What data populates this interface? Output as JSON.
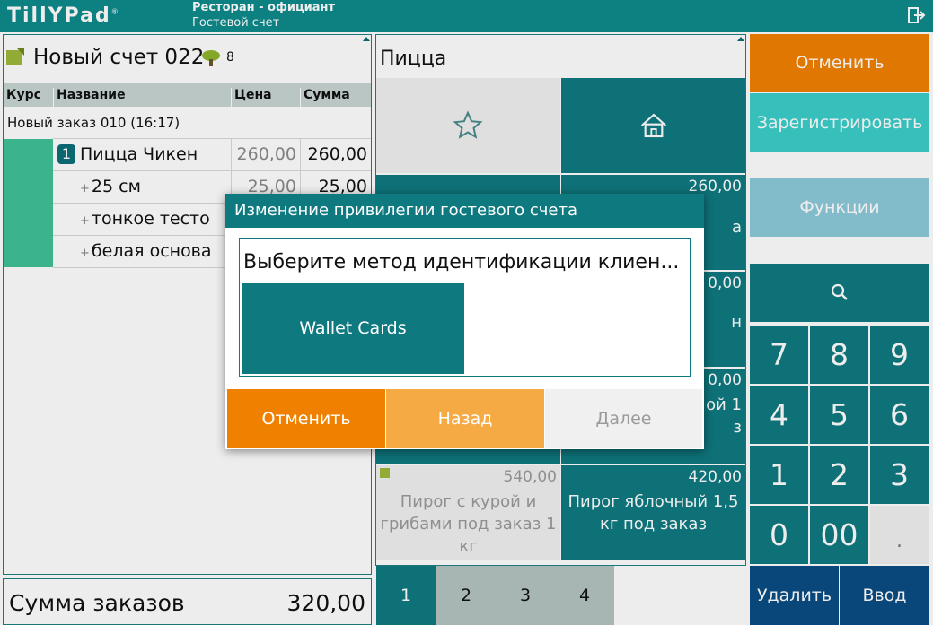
{
  "topbar": {
    "logo": "TillYPad",
    "title": "Ресторан - официант",
    "subtitle": "Гостевой счет",
    "logout_icon": "logout-icon"
  },
  "bill": {
    "title": "Новый счет 022",
    "guests": "8",
    "columns": {
      "course": "Курс",
      "name": "Название",
      "price": "Цена",
      "sum": "Сумма"
    },
    "order_label": "Новый заказ 010 (16:17)",
    "items": [
      {
        "qty": "1",
        "name": "Пицца Чикен",
        "price": "260,00",
        "sum": "260,00"
      },
      {
        "name": "25 см",
        "price": "25,00",
        "sum": "25,00"
      },
      {
        "name": "тонкое тесто",
        "price": "",
        "sum": ""
      },
      {
        "name": "белая основа",
        "price": "",
        "sum": ""
      }
    ],
    "total_label": "Сумма заказов",
    "total_value": "320,00",
    "course_color": "#40c197"
  },
  "menu": {
    "category": "Пицца",
    "tiles": [
      {
        "price": "",
        "name": "",
        "icon": "star-icon"
      },
      {
        "price": "",
        "name": "",
        "icon": "home-icon"
      },
      {
        "price": "",
        "name": ""
      },
      {
        "price": "260,00",
        "name": "a"
      },
      {
        "price": "",
        "name": ""
      },
      {
        "price": "0,00",
        "name": "н"
      },
      {
        "price": "",
        "name": ""
      },
      {
        "price": "0,00",
        "name": "ой 1\nз"
      },
      {
        "price": "540,00",
        "name": "Пирог с курой и грибами под заказ 1 кг"
      },
      {
        "price": "420,00",
        "name": "Пирог яблочный 1,5 кг под заказ"
      }
    ],
    "pages": [
      "1",
      "2",
      "3",
      "4"
    ]
  },
  "actions": {
    "cancel": "Отменить",
    "register": "Зарегистрировать",
    "functions": "Функции",
    "search_icon": "search-icon",
    "delete": "Удалить",
    "enter": "Ввод"
  },
  "keypad": [
    "7",
    "8",
    "9",
    "4",
    "5",
    "6",
    "1",
    "2",
    "3",
    "0",
    "00",
    "."
  ],
  "dialog": {
    "title": "Изменение привилегии гостевого счета",
    "prompt": "Выберите метод идентификации клиен...",
    "option": "Wallet Cards",
    "cancel": "Отменить",
    "back": "Назад",
    "next": "Далее"
  },
  "colors": {
    "teal": "#0e7a80",
    "orange": "#f08000",
    "light_orange": "#f5aa44",
    "aqua": "#3ccfca",
    "light_blue": "#8ccad9",
    "navy": "#0a4c84"
  }
}
